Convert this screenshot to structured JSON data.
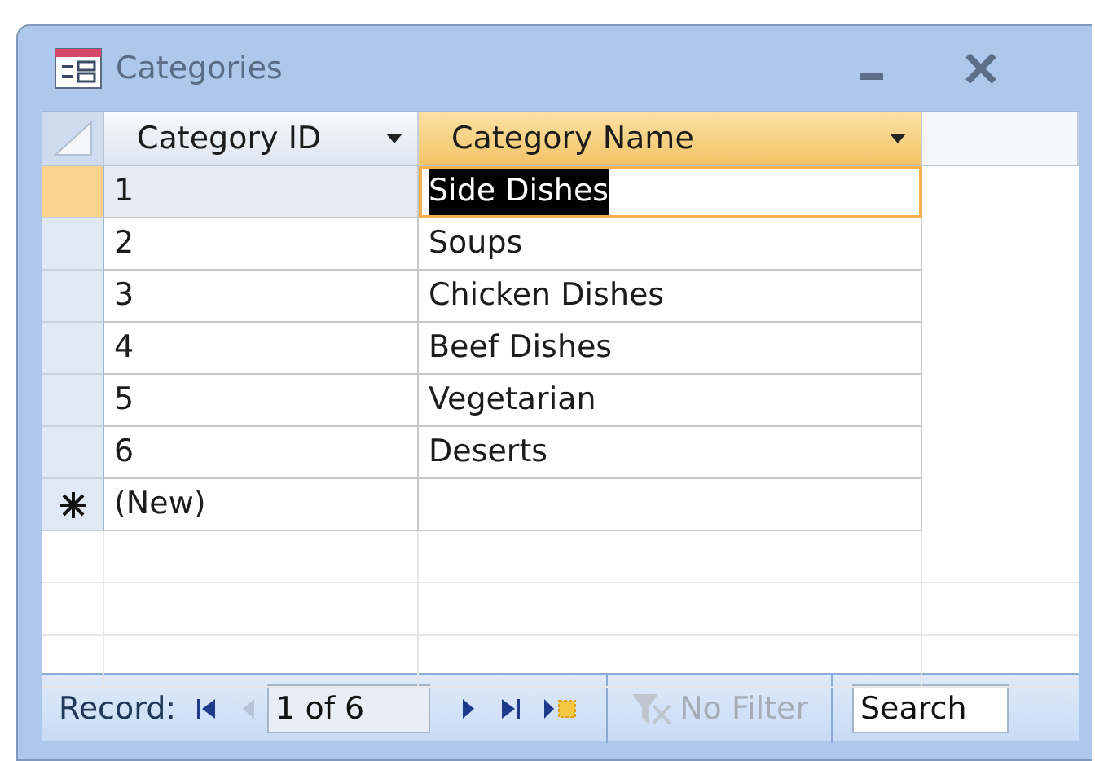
{
  "window": {
    "title": "Categories"
  },
  "columns": [
    {
      "label": "Category ID",
      "selected": false
    },
    {
      "label": "Category Name",
      "selected": true
    }
  ],
  "rows": [
    {
      "cells": [
        "1",
        "Side Dishes"
      ],
      "selected": true
    },
    {
      "cells": [
        "2",
        "Soups"
      ],
      "selected": false
    },
    {
      "cells": [
        "3",
        "Chicken Dishes"
      ],
      "selected": false
    },
    {
      "cells": [
        "4",
        "Beef Dishes"
      ],
      "selected": false
    },
    {
      "cells": [
        "5",
        "Vegetarian"
      ],
      "selected": false
    },
    {
      "cells": [
        "6",
        "Deserts"
      ],
      "selected": false
    }
  ],
  "new_row": {
    "label": "(New)"
  },
  "navigation": {
    "label": "Record:",
    "position": "1 of 6",
    "filter": {
      "label": "No Filter",
      "disabled": true
    },
    "search": {
      "placeholder": "Search"
    }
  }
}
